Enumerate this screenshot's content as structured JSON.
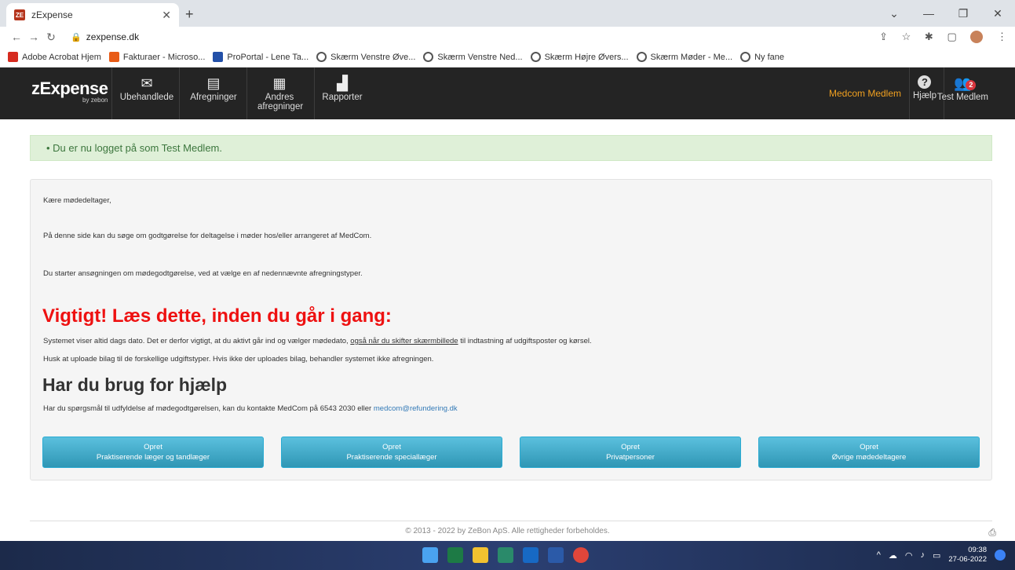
{
  "browser": {
    "tab_title": "zExpense",
    "tab_favicon": "ZE",
    "url": "zexpense.dk",
    "bookmarks": [
      {
        "label": "Adobe Acrobat Hjem",
        "icon": "acrobat-icon"
      },
      {
        "label": "Fakturaer - Microso...",
        "icon": "office-icon"
      },
      {
        "label": "ProPortal - Lene Ta...",
        "icon": "proportal-icon"
      },
      {
        "label": "Skærm Venstre Øve...",
        "icon": "globe-icon"
      },
      {
        "label": "Skærm Venstre Ned...",
        "icon": "globe-icon"
      },
      {
        "label": "Skærm Højre Øvers...",
        "icon": "globe-icon"
      },
      {
        "label": "Skærm Møder - Me...",
        "icon": "globe-icon"
      },
      {
        "label": "Ny fane",
        "icon": "globe-icon"
      }
    ]
  },
  "app": {
    "brand": "zExpense",
    "brand_by": "by zebon",
    "nav": [
      {
        "label": "Ubehandlede",
        "icon": "inbox-icon"
      },
      {
        "label": "Afregninger",
        "icon": "document-icon"
      },
      {
        "label": "Andres afregninger",
        "icon": "documents-icon"
      },
      {
        "label": "Rapporter",
        "icon": "chart-icon"
      }
    ],
    "user_org": "Medcom Medlem",
    "help_label": "Hjælp",
    "user_name": "Test Medlem",
    "user_badge": "2"
  },
  "alert": "Du er nu logget på som Test Medlem.",
  "content": {
    "greeting": "Kære mødedeltager,",
    "intro": "På denne side kan du søge om godtgørelse for deltagelse i møder hos/eller arrangeret af MedCom.",
    "start": "Du starter ansøgningen om mødegodtgørelse, ved at vælge en af nedennævnte afregningstyper.",
    "warning_title": "Vigtigt! Læs dette, inden du går i gang:",
    "warning_1a": "Systemet viser altid dags dato. Det er derfor vigtigt, at du aktivt går ind og vælger mødedato, ",
    "warning_1b": "også når du skifter skærmbillede",
    "warning_1c": " til indtastning af udgiftsposter og kørsel.",
    "warning_2": "Husk at uploade bilag til de forskellige udgiftstyper. Hvis ikke der uploades bilag, behandler systemet ikke afregningen.",
    "help_title": "Har du brug for hjælp",
    "help_text": "Har du spørgsmål til udfyldelse af mødegodtgørelsen, kan du kontakte MedCom på 6543 2030 eller ",
    "help_email": "medcom@refundering.dk",
    "buttons": [
      {
        "line1": "Opret",
        "line2": "Praktiserende læger og tandlæger"
      },
      {
        "line1": "Opret",
        "line2": "Praktiserende speciallæger"
      },
      {
        "line1": "Opret",
        "line2": "Privatpersoner"
      },
      {
        "line1": "Opret",
        "line2": "Øvrige mødedeltagere"
      }
    ]
  },
  "footer": "© 2013 - 2022 by ZeBon ApS. Alle rettigheder forbeholdes.",
  "taskbar": {
    "time": "09:38",
    "date": "27-06-2022"
  },
  "colors": {
    "nav_bg": "#242424",
    "warning": "#ee1111",
    "button": "#5bc0de",
    "alert_bg": "#dff0d8"
  }
}
